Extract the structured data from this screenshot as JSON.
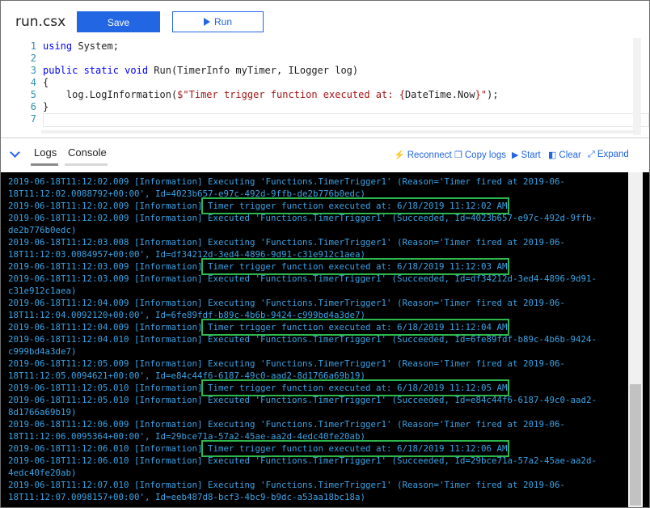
{
  "file": {
    "name": "run.csx"
  },
  "toolbar": {
    "save_label": "Save",
    "run_label": "Run"
  },
  "editor": {
    "lines": [
      {
        "num": "1",
        "parts": [
          {
            "t": "kw",
            "v": "using"
          },
          {
            "t": "txt",
            "v": " System;"
          }
        ]
      },
      {
        "num": "2",
        "parts": []
      },
      {
        "num": "3",
        "parts": [
          {
            "t": "kw",
            "v": "public static void"
          },
          {
            "t": "txt",
            "v": " Run(TimerInfo myTimer, ILogger log)"
          }
        ]
      },
      {
        "num": "4",
        "parts": [
          {
            "t": "txt",
            "v": "{"
          }
        ]
      },
      {
        "num": "5",
        "parts": [
          {
            "t": "txt",
            "v": "    log.LogInformation("
          },
          {
            "t": "str",
            "v": "$\"Timer trigger function executed at: {"
          },
          {
            "t": "txt",
            "v": "DateTime.Now"
          },
          {
            "t": "str",
            "v": "}\""
          },
          {
            "t": "txt",
            "v": ");"
          }
        ]
      },
      {
        "num": "6",
        "parts": [
          {
            "t": "txt",
            "v": "}"
          }
        ]
      },
      {
        "num": "7",
        "parts": []
      }
    ]
  },
  "tabs": {
    "logs": "Logs",
    "console": "Console"
  },
  "actions": {
    "reconnect": "Reconnect",
    "copy_logs": "Copy logs",
    "start": "Start",
    "clear": "Clear",
    "expand": "Expand"
  },
  "logs": [
    "2019-06-18T11:12:02.009 [Information] Executing 'Functions.TimerTrigger1' (Reason='Timer fired at 2019-06-",
    "18T11:12:02.0088792+00:00', Id=4023b657-e97c-492d-9ffb-de2b776b0edc)",
    "2019-06-18T11:12:02.009 [Information] Timer trigger function executed at: 6/18/2019 11:12:02 AM",
    "2019-06-18T11:12:02.009 [Information] Executed 'Functions.TimerTrigger1' (Succeeded, Id=4023b657-e97c-492d-9ffb-",
    "de2b776b0edc)",
    "2019-06-18T11:12:03.008 [Information] Executing 'Functions.TimerTrigger1' (Reason='Timer fired at 2019-06-",
    "18T11:12:03.0084957+00:00', Id=df34212d-3ed4-4896-9d91-c31e912c1aea)",
    "2019-06-18T11:12:03.009 [Information] Timer trigger function executed at: 6/18/2019 11:12:03 AM",
    "2019-06-18T11:12:03.009 [Information] Executed 'Functions.TimerTrigger1' (Succeeded, Id=df34212d-3ed4-4896-9d91-",
    "c31e912c1aea)",
    "2019-06-18T11:12:04.009 [Information] Executing 'Functions.TimerTrigger1' (Reason='Timer fired at 2019-06-",
    "18T11:12:04.0092120+00:00', Id=6fe89fdf-b89c-4b6b-9424-c999bd4a3de7)",
    "2019-06-18T11:12:04.009 [Information] Timer trigger function executed at: 6/18/2019 11:12:04 AM",
    "2019-06-18T11:12:04.010 [Information] Executed 'Functions.TimerTrigger1' (Succeeded, Id=6fe89fdf-b89c-4b6b-9424-",
    "c999bd4a3de7)",
    "2019-06-18T11:12:05.009 [Information] Executing 'Functions.TimerTrigger1' (Reason='Timer fired at 2019-06-",
    "18T11:12:05.0094621+00:00', Id=e84c44f6-6187-49c0-aad2-8d1766a69b19)",
    "2019-06-18T11:12:05.010 [Information] Timer trigger function executed at: 6/18/2019 11:12:05 AM",
    "2019-06-18T11:12:05.010 [Information] Executed 'Functions.TimerTrigger1' (Succeeded, Id=e84c44f6-6187-49c0-aad2-",
    "8d1766a69b19)",
    "2019-06-18T11:12:06.009 [Information] Executing 'Functions.TimerTrigger1' (Reason='Timer fired at 2019-06-",
    "18T11:12:06.0095364+00:00', Id=29bce71a-57a2-45ae-aa2d-4edc40fe20ab)",
    "2019-06-18T11:12:06.010 [Information] Timer trigger function executed at: 6/18/2019 11:12:06 AM",
    "2019-06-18T11:12:06.010 [Information] Executed 'Functions.TimerTrigger1' (Succeeded, Id=29bce71a-57a2-45ae-aa2d-",
    "4edc40fe20ab)",
    "2019-06-18T11:12:07.010 [Information] Executing 'Functions.TimerTrigger1' (Reason='Timer fired at 2019-06-",
    "18T11:12:07.0098157+00:00', Id=eeb487d8-bcf3-4bc9-b9dc-a53aa18bc18a)"
  ],
  "highlight_rows": [
    2,
    7,
    12,
    17,
    22
  ],
  "colors": {
    "accent": "#2266e3",
    "log_text": "#3ba3e6",
    "highlight": "#2db84b"
  }
}
